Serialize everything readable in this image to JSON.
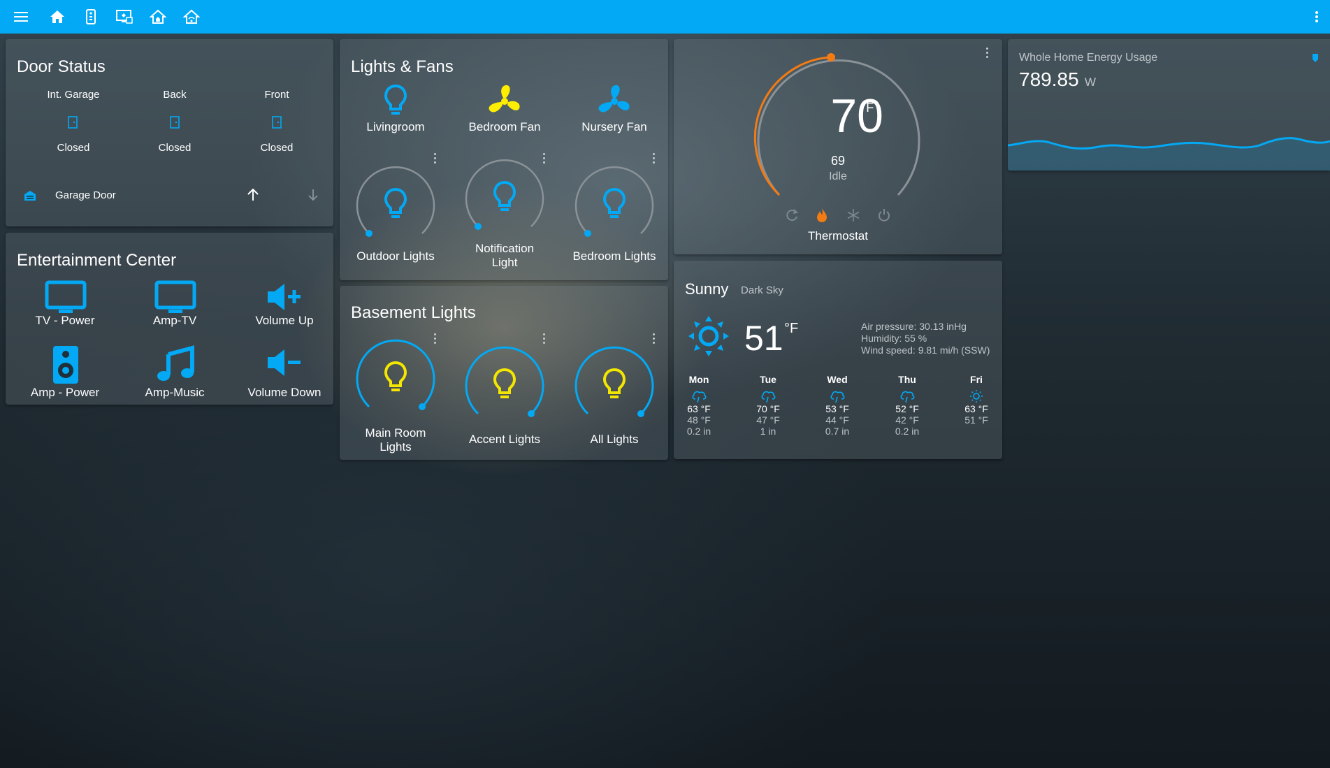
{
  "colors": {
    "accent": "#03a9f4",
    "yellow": "#f3e600",
    "heat": "#f37b14",
    "fan_on": "#ffee00"
  },
  "topbar": {
    "icons": [
      "menu-icon",
      "home-icon",
      "remote-icon",
      "monitor-icon",
      "house-icon",
      "house-signal-icon"
    ]
  },
  "door_status": {
    "title": "Door Status",
    "doors": [
      {
        "name": "Int. Garage",
        "state": "Closed"
      },
      {
        "name": "Back",
        "state": "Closed"
      },
      {
        "name": "Front",
        "state": "Closed"
      }
    ],
    "garage": {
      "label": "Garage Door"
    }
  },
  "entertainment": {
    "title": "Entertainment Center",
    "buttons": [
      {
        "label": "TV - Power",
        "icon": "tv-icon"
      },
      {
        "label": "Amp-TV",
        "icon": "tv-icon"
      },
      {
        "label": "Volume Up",
        "icon": "volume-plus-icon"
      },
      {
        "label": "Amp - Power",
        "icon": "speaker-icon"
      },
      {
        "label": "Amp-Music",
        "icon": "music-icon"
      },
      {
        "label": "Volume Down",
        "icon": "volume-minus-icon"
      }
    ]
  },
  "lights_fans": {
    "title": "Lights & Fans",
    "buttons": [
      {
        "label": "Livingroom",
        "icon": "bulb-icon"
      },
      {
        "label": "Bedroom Fan",
        "icon": "fan-icon"
      },
      {
        "label": "Nursery Fan",
        "icon": "fan-icon"
      }
    ],
    "dials": [
      {
        "label": "Outdoor Lights"
      },
      {
        "label": "Notification Light"
      },
      {
        "label": "Bedroom Lights"
      }
    ]
  },
  "basement": {
    "title": "Basement Lights",
    "dials": [
      {
        "label": "Main Room Lights"
      },
      {
        "label": "Accent Lights"
      },
      {
        "label": "All Lights"
      }
    ]
  },
  "thermostat": {
    "target": "70",
    "unit": "°F",
    "current": "69",
    "state": "Idle",
    "name": "Thermostat",
    "modes": [
      "auto-icon",
      "flame-icon",
      "snowflake-icon",
      "power-icon"
    ]
  },
  "weather": {
    "condition": "Sunny",
    "source": "Dark Sky",
    "temp": "51",
    "unit": "°F",
    "pressure": "Air pressure: 30.13 inHg",
    "humidity": "Humidity: 55 %",
    "wind": "Wind speed: 9.81 mi/h (SSW)",
    "forecast": [
      {
        "day": "Mon",
        "icon": "rain-icon",
        "high": "63 °F",
        "low": "48 °F",
        "precip": "0.2 in"
      },
      {
        "day": "Tue",
        "icon": "rain-icon",
        "high": "70 °F",
        "low": "47 °F",
        "precip": "1 in"
      },
      {
        "day": "Wed",
        "icon": "rain-icon",
        "high": "53 °F",
        "low": "44 °F",
        "precip": "0.7 in"
      },
      {
        "day": "Thu",
        "icon": "rain-icon",
        "high": "52 °F",
        "low": "42 °F",
        "precip": "0.2 in"
      },
      {
        "day": "Fri",
        "icon": "sun-icon",
        "high": "63 °F",
        "low": "51 °F",
        "precip": ""
      }
    ]
  },
  "energy": {
    "title": "Whole Home Energy Usage",
    "value": "789.85",
    "unit": "W"
  }
}
